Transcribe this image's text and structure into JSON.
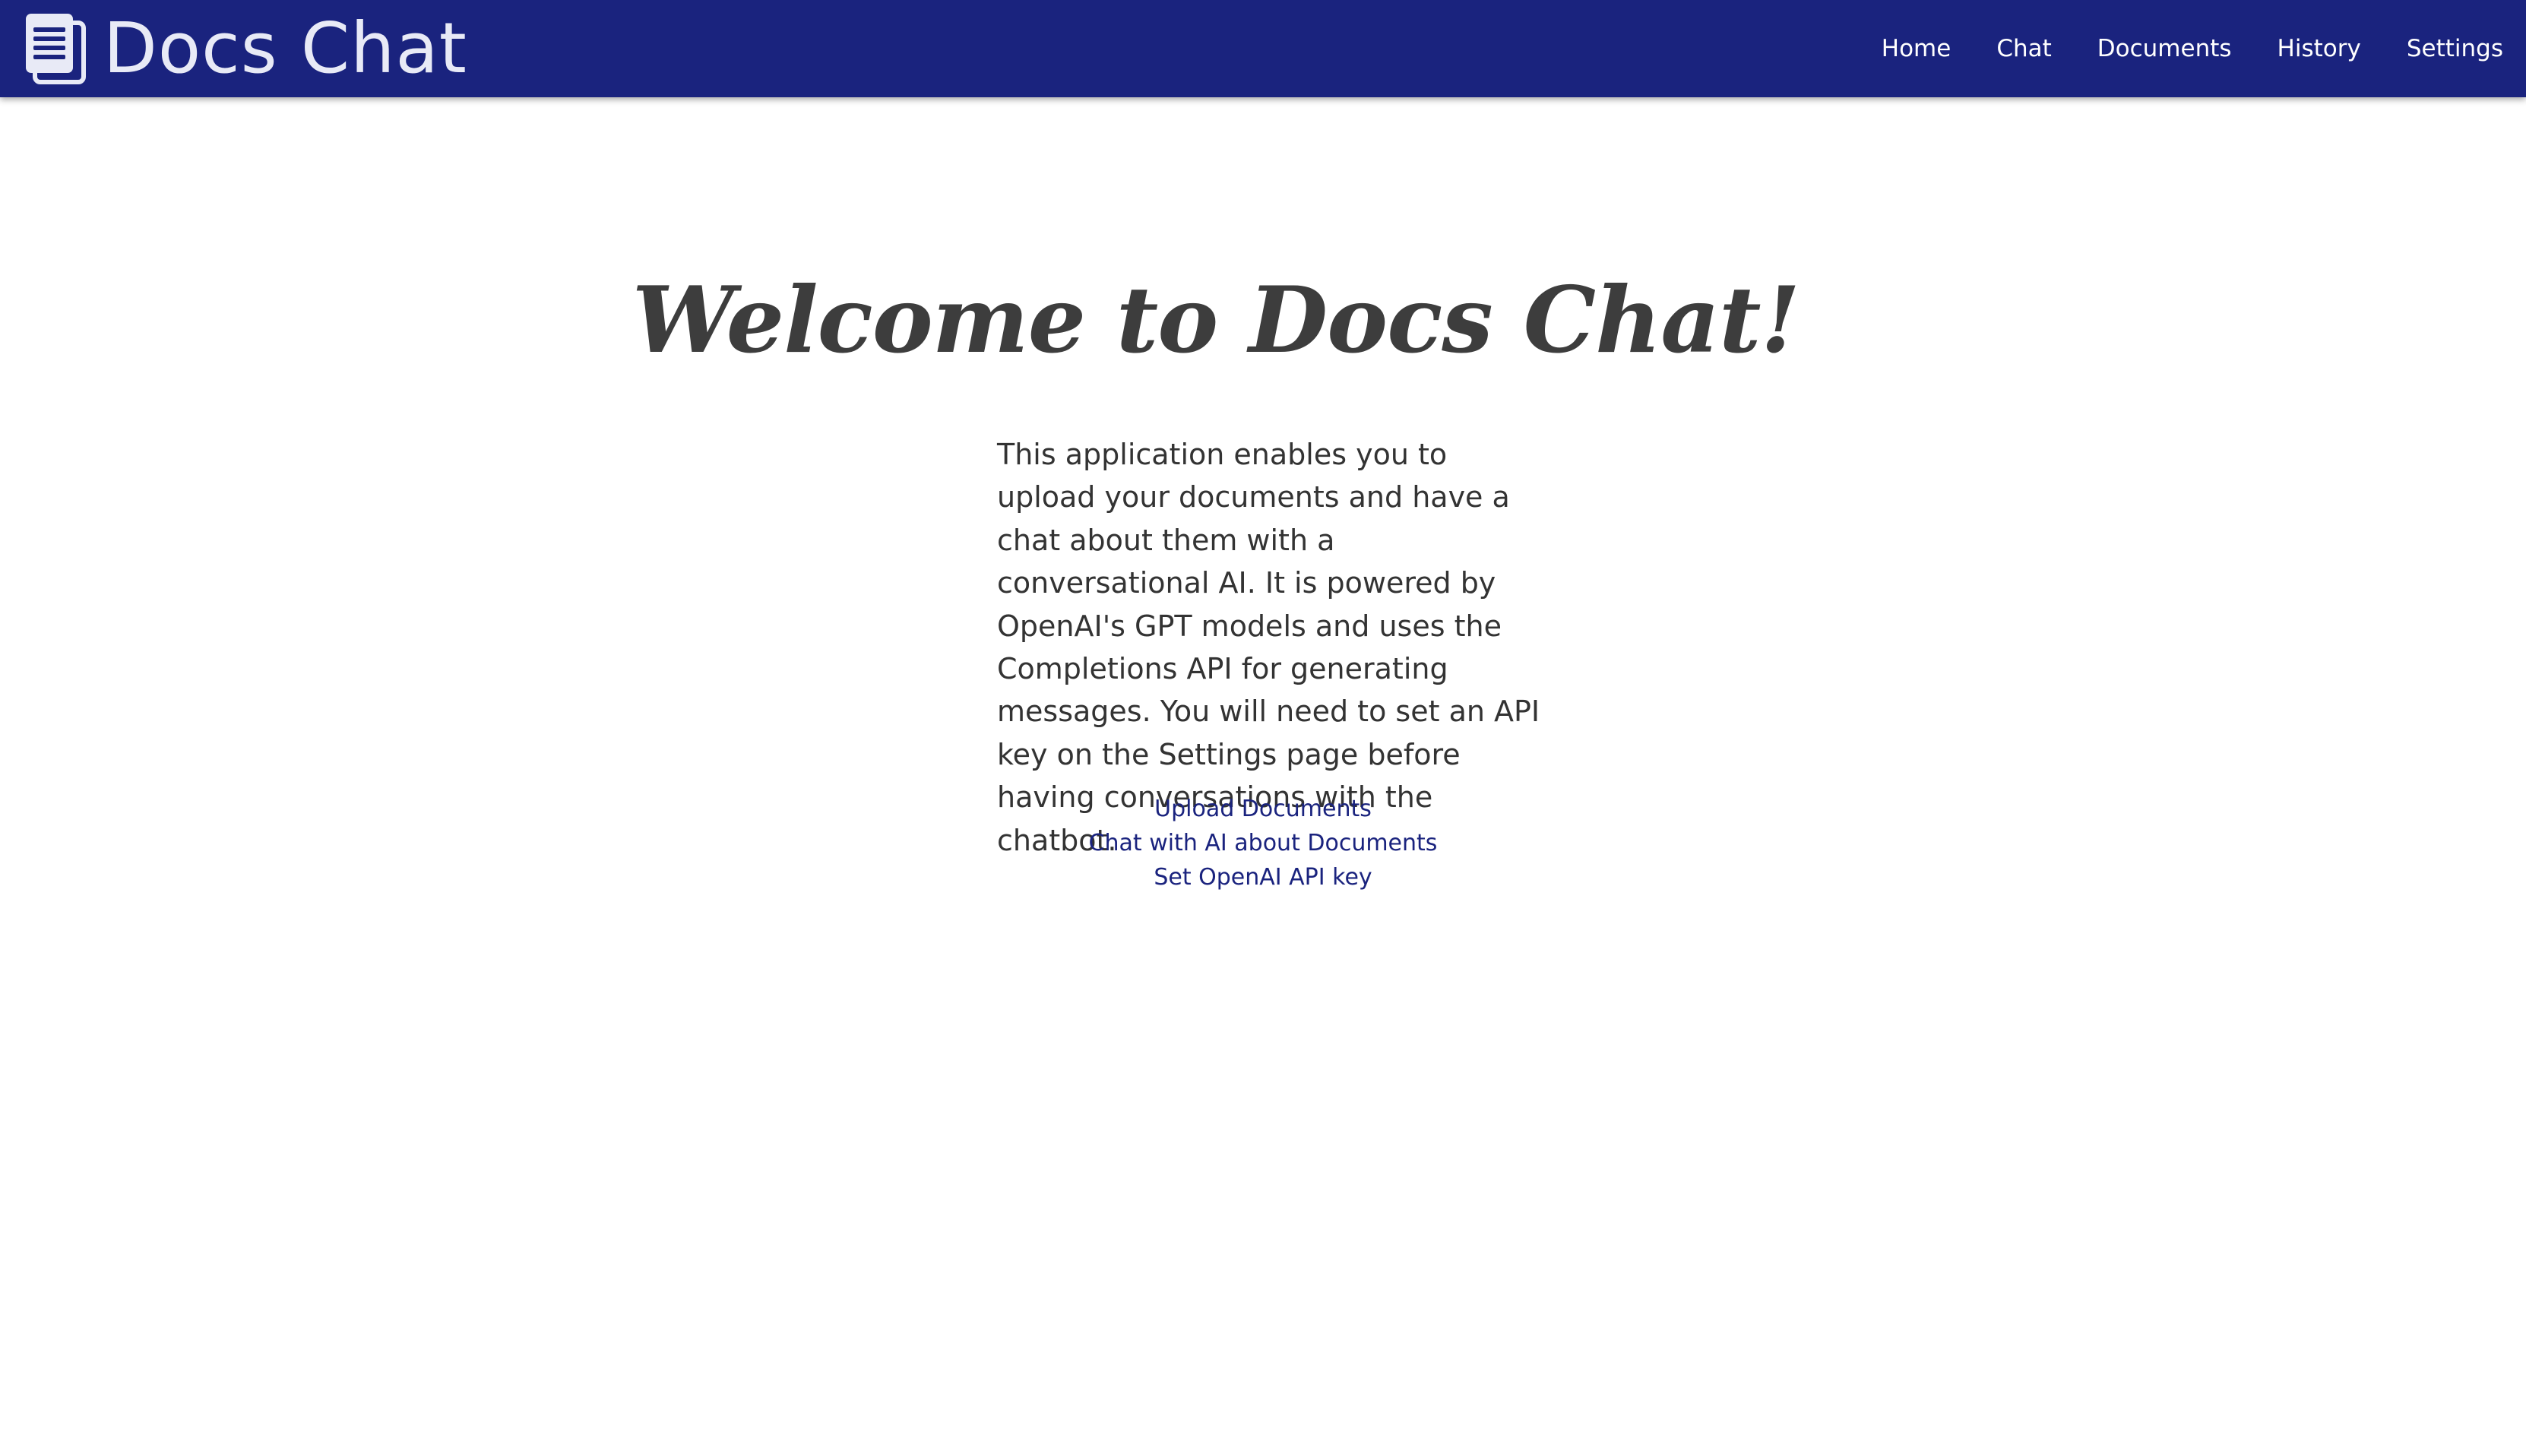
{
  "brand": {
    "title": "Docs Chat",
    "icon": "document-icon"
  },
  "nav": {
    "items": [
      {
        "label": "Home"
      },
      {
        "label": "Chat"
      },
      {
        "label": "Documents"
      },
      {
        "label": "History"
      },
      {
        "label": "Settings"
      }
    ]
  },
  "main": {
    "heading": "Welcome to Docs Chat!",
    "description": "This application enables you to upload your documents and have a chat about them with a conversational AI. It is powered by OpenAI's GPT models and uses the Completions API for generating messages. You will need to set an API key on the Settings page before having conversations with the chatbot.",
    "links": [
      {
        "label": "Upload Documents"
      },
      {
        "label": "Chat with AI about Documents"
      },
      {
        "label": "Set OpenAI API key"
      }
    ]
  },
  "colors": {
    "navbar": "#1a237e",
    "link": "#1a237e",
    "text": "#333333"
  }
}
